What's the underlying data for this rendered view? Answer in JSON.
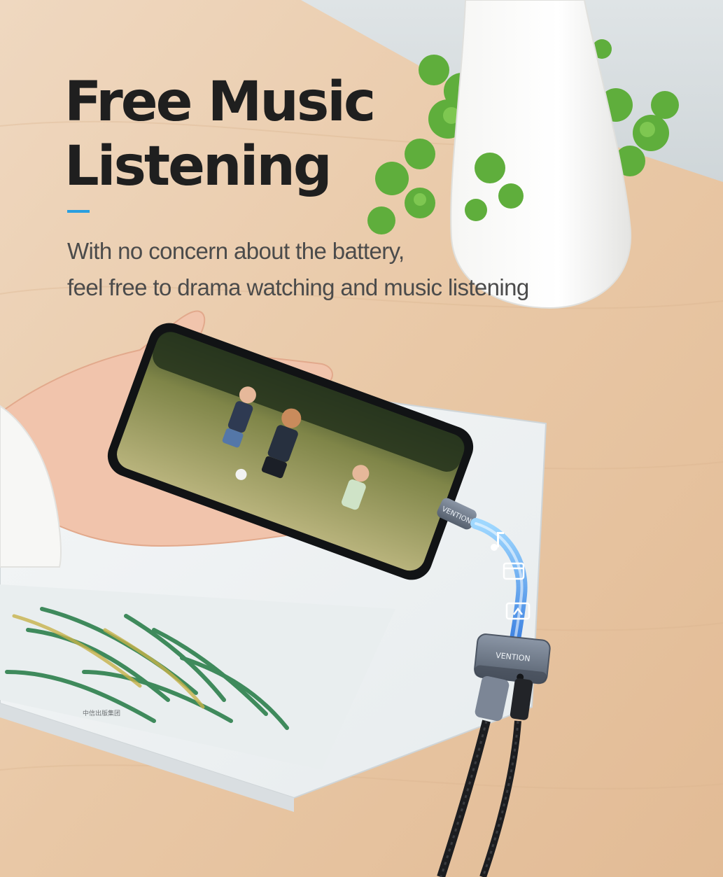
{
  "headline": {
    "line1": "Free Music",
    "line2": "Listening"
  },
  "subline": {
    "line1": "With no concern about the battery,",
    "line2": "feel free to drama watching and music listening"
  },
  "brand": {
    "adapter_label": "VENTION",
    "connector_label": "VENTION"
  },
  "magazine": {
    "caption": "中信出版集团"
  },
  "colors": {
    "accent": "#2a9fe0",
    "text": "#1f1f1f",
    "subtext": "#4b4b4b",
    "table": "#e8c9a8"
  }
}
